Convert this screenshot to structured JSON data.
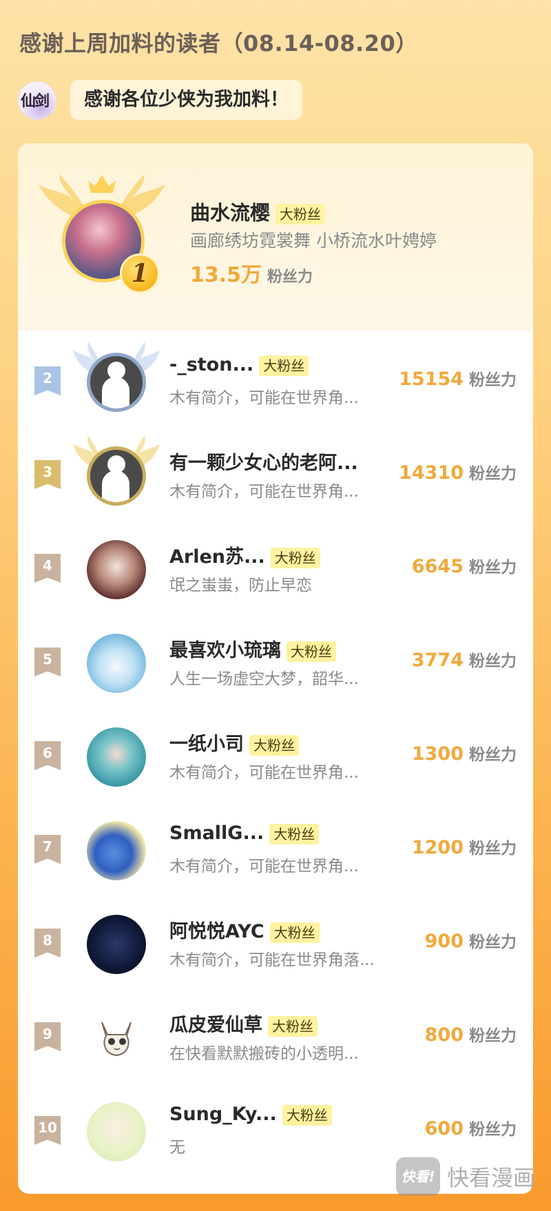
{
  "header": {
    "title": "感谢上周加料的读者（08.14-08.20）",
    "logo_text": "仙剑",
    "thanks_message": "感谢各位少侠为我加料！"
  },
  "top_fan": {
    "rank": "1",
    "name": "曲水流樱",
    "badge": "大粉丝",
    "desc": "画廊绣坊霓裳舞 小桥流水叶娉婷",
    "power_value": "13.5万",
    "power_unit": "粉丝力"
  },
  "fans": [
    {
      "rank": "2",
      "name": "-_ston...",
      "badge": "大粉丝",
      "desc": "木有简介，可能在世界角...",
      "power_value": "15154",
      "power_unit": "粉丝力"
    },
    {
      "rank": "3",
      "name": "有一颗少女心的老阿...",
      "badge": "",
      "desc": "木有简介，可能在世界角...",
      "power_value": "14310",
      "power_unit": "粉丝力"
    },
    {
      "rank": "4",
      "name": "Arlen苏...",
      "badge": "大粉丝",
      "desc": "氓之蚩蚩，防止早恋",
      "power_value": "6645",
      "power_unit": "粉丝力"
    },
    {
      "rank": "5",
      "name": "最喜欢小琉璃",
      "badge": "大粉丝",
      "desc": "人生一场虚空大梦，韶华...",
      "power_value": "3774",
      "power_unit": "粉丝力"
    },
    {
      "rank": "6",
      "name": "一纸小司",
      "badge": "大粉丝",
      "desc": "木有简介，可能在世界角...",
      "power_value": "1300",
      "power_unit": "粉丝力"
    },
    {
      "rank": "7",
      "name": "SmallG...",
      "badge": "大粉丝",
      "desc": "木有简介，可能在世界角...",
      "power_value": "1200",
      "power_unit": "粉丝力"
    },
    {
      "rank": "8",
      "name": "阿悦悦AYC",
      "badge": "大粉丝",
      "desc": "木有简介，可能在世界角落...",
      "power_value": "900",
      "power_unit": "粉丝力"
    },
    {
      "rank": "9",
      "name": "瓜皮爱仙草",
      "badge": "大粉丝",
      "desc": "在快看默默搬砖的小透明...",
      "power_value": "800",
      "power_unit": "粉丝力"
    },
    {
      "rank": "10",
      "name": "Sung_Ky...",
      "badge": "大粉丝",
      "desc": "无",
      "power_value": "600",
      "power_unit": "粉丝力"
    }
  ],
  "watermark": {
    "logo_text": "快看!",
    "text": "快看漫画"
  },
  "colors": {
    "accent_orange": "#f0a93b",
    "badge_bg": "#fff2a0",
    "rank2": "#a9c3e6",
    "rank3": "#d9bd6c",
    "rank_other": "#c9b39e"
  }
}
